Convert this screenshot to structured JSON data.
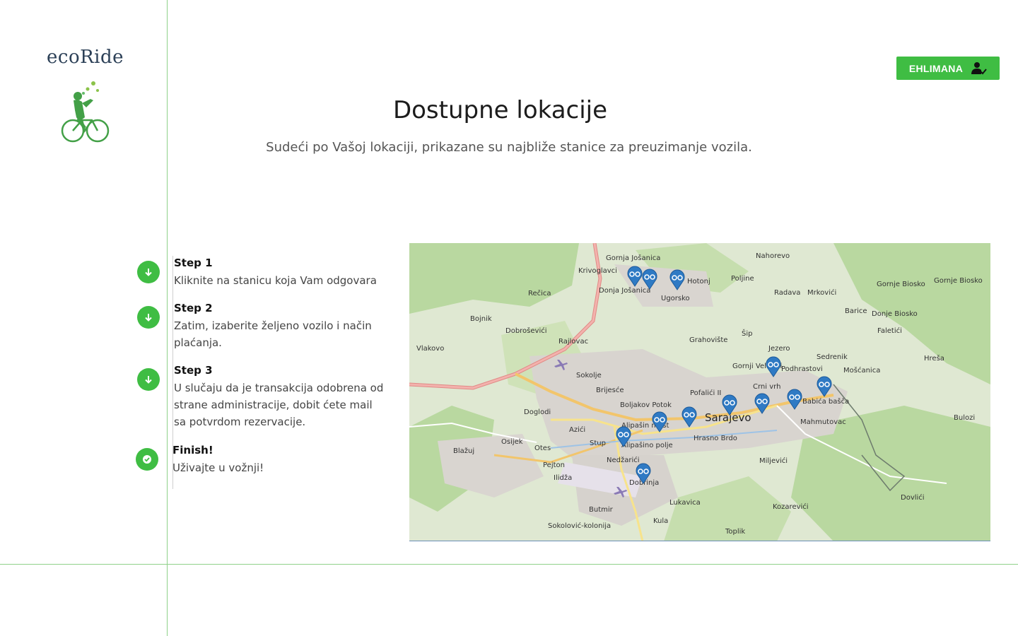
{
  "brand": {
    "name": "ecoRide"
  },
  "user": {
    "name": "EHLIMANA",
    "icon": "user-check-icon"
  },
  "header": {
    "title": "Dostupne lokacije",
    "subtitle": "Sudeći po Vašoj lokaciji, prikazane su najbliže stanice za preuzimanje vozila."
  },
  "steps": [
    {
      "title": "Step 1",
      "text": "Kliknite na stanicu koja Vam odgovara",
      "icon": "arrow-down-icon"
    },
    {
      "title": "Step 2",
      "text": "Zatim, izaberite željeno vozilo i način plaćanja.",
      "icon": "arrow-down-icon"
    },
    {
      "title": "Step 3",
      "text": "U slučaju da je transakcija odobrena od strane administracije, dobit ćete mail sa potvrdom rezervacije.",
      "icon": "arrow-down-icon"
    },
    {
      "title": "Finish!",
      "text": "Uživajte u vožnji!",
      "icon": "check-circle-icon"
    }
  ],
  "map": {
    "places": [
      "Gornja Jošanica",
      "Krivoglavci",
      "Donja Jošanica",
      "Hotonj",
      "Ugorsko",
      "Poljine",
      "Nahorevo",
      "Radava",
      "Mrkovići",
      "Gornje Biosko",
      "Donje Biosko",
      "Barice",
      "Faletići",
      "Rečica",
      "Bojnik",
      "Dobroševići",
      "Rajlovac",
      "Vlakovo",
      "Sokolje",
      "Brijesće",
      "Boljakov Potok",
      "Pofalići II",
      "Grahovište",
      "Šip",
      "Jezero",
      "Gornji Velešići",
      "Podhrastovi",
      "Sedrenik",
      "Mošćanica",
      "Hreša",
      "Crni vrh",
      "Babića bašča",
      "Mahmutovac",
      "Bulozi",
      "Doglodi",
      "Azići",
      "Alipašin most",
      "Alipašino polje",
      "Hrasno Brdo",
      "Osijek",
      "Otes",
      "Stup",
      "Blažuj",
      "Nedžarići",
      "Miljevići",
      "Pejton",
      "Dobrinja",
      "Ilidža",
      "Lukavica",
      "Butmir",
      "Kula",
      "Kozarevići",
      "Sokolović-kolonija",
      "Toplik",
      "Dovlići"
    ],
    "city": "Sarajevo",
    "station_count": 11
  }
}
